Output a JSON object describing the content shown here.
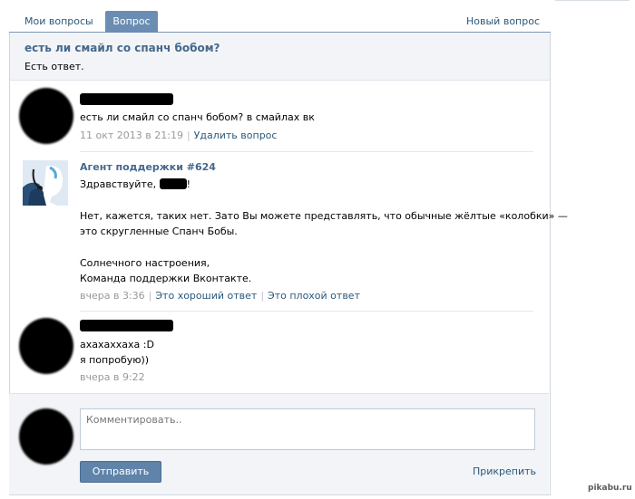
{
  "tabs": {
    "my_questions": "Мои вопросы",
    "question": "Вопрос",
    "new_question": "Новый вопрос"
  },
  "question": {
    "title": "есть ли смайл со спанч бобом?",
    "status": "Есть ответ."
  },
  "posts": [
    {
      "author": "",
      "lines": [
        "есть ли смайл со спанч бобом? в смайлах вк"
      ],
      "time": "11 окт 2013 в 21:19",
      "actions": [
        "Удалить вопрос"
      ]
    },
    {
      "author": "Агент поддержки #624",
      "greeting": "Здравствуйте,",
      "greeting_end": "!",
      "lines": [
        "Нет, кажется, таких нет. Зато Вы можете представлять, что обычные жёлтые «колобки» —",
        "это скругленные Спанч Бобы.",
        "Солнечного настроения,",
        "Команда поддержки Вконтакте."
      ],
      "time": "вчера в 3:36",
      "actions": [
        "Это хороший ответ",
        "Это плохой ответ"
      ]
    },
    {
      "author": "",
      "lines": [
        "ахахаххаха :D",
        "я попробую))"
      ],
      "time": "вчера в 9:22"
    }
  ],
  "comment": {
    "placeholder": "Комментировать..",
    "send_label": "Отправить",
    "attach_label": "Прикрепить"
  },
  "watermark": "pikabu.ru",
  "colors": {
    "link": "#2b587a",
    "author": "#45688e",
    "tab_active_bg": "#6b8db3",
    "button_bg": "#6083a9",
    "header_bg": "#f2f4f7"
  },
  "icons": {
    "agent_avatar": "support-agent-icon"
  }
}
